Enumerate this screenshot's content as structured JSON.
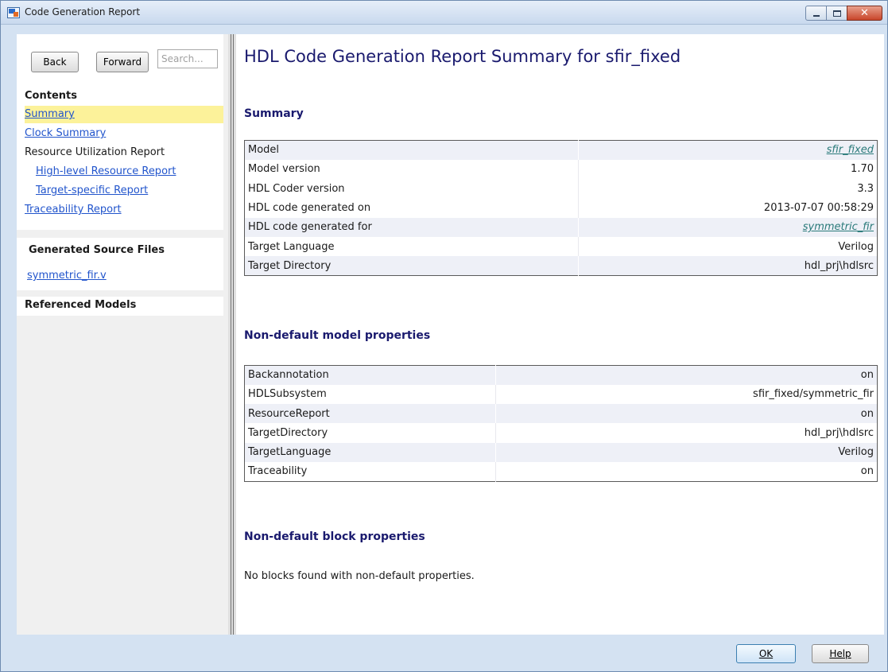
{
  "window": {
    "title": "Code Generation Report"
  },
  "sidebar": {
    "back_label": "Back",
    "forward_label": "Forward",
    "search_placeholder": "Search...",
    "contents_title": "Contents",
    "nav": {
      "summary": "Summary",
      "clock_summary": "Clock Summary",
      "resource_utilization": "Resource Utilization Report",
      "high_level_resource": "High-level Resource Report",
      "target_specific": "Target-specific Report",
      "traceability": "Traceability Report"
    },
    "generated_source_title": "Generated Source Files",
    "source_files": [
      "symmetric_fir.v"
    ],
    "referenced_models_title": "Referenced Models"
  },
  "main": {
    "page_title": "HDL Code Generation Report Summary for sfir_fixed",
    "summary": {
      "title": "Summary",
      "rows": [
        {
          "key": "Model",
          "value": "sfir_fixed"
        },
        {
          "key": "Model version",
          "value": "1.70"
        },
        {
          "key": "HDL Coder version",
          "value": "3.3"
        },
        {
          "key": "HDL code generated on",
          "value": "2013-07-07 00:58:29"
        },
        {
          "key": "HDL code generated for",
          "value": "symmetric_fir"
        },
        {
          "key": "Target Language",
          "value": "Verilog"
        },
        {
          "key": "Target Directory",
          "value": "hdl_prj\\hdlsrc"
        }
      ]
    },
    "model_props": {
      "title": "Non-default model properties",
      "rows": [
        {
          "key": "Backannotation",
          "value": "on"
        },
        {
          "key": "HDLSubsystem",
          "value": "sfir_fixed/symmetric_fir"
        },
        {
          "key": "ResourceReport",
          "value": "on"
        },
        {
          "key": "TargetDirectory",
          "value": "hdl_prj\\hdlsrc"
        },
        {
          "key": "TargetLanguage",
          "value": "Verilog"
        },
        {
          "key": "Traceability",
          "value": "on"
        }
      ]
    },
    "block_props": {
      "title": "Non-default block properties",
      "message": "No blocks found with non-default properties."
    }
  },
  "footer": {
    "ok_label": "OK",
    "help_label": "Help"
  },
  "colors": {
    "heading": "#1a1a6e",
    "link": "#2255cc",
    "active_nav": "#fcf29a",
    "shaded_row": "#eef0f7"
  }
}
